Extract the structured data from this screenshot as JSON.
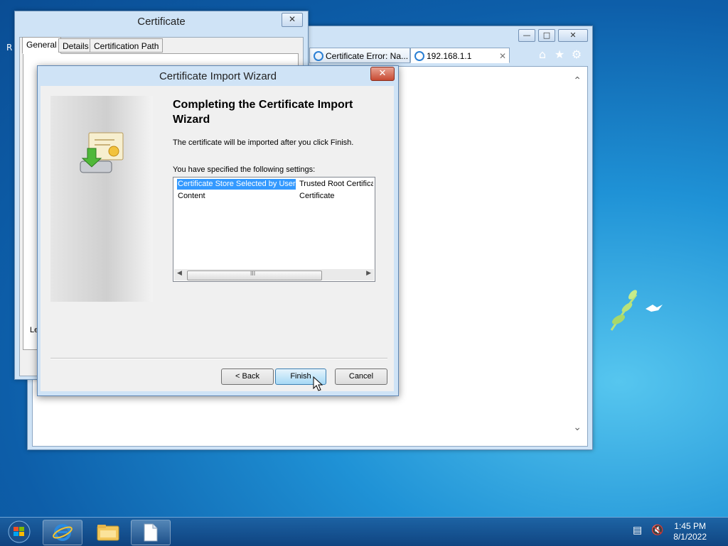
{
  "browser": {
    "tabs": [
      {
        "label": "Certificate Error: Na..."
      },
      {
        "label": "192.168.1.1"
      }
    ],
    "desktop_cut_text": "R"
  },
  "cert_window": {
    "title": "Certificate",
    "tabs": [
      "General",
      "Details",
      "Certification Path"
    ],
    "partial_text": "Le"
  },
  "wizard": {
    "title": "Certificate Import Wizard",
    "heading": "Completing the Certificate Import Wizard",
    "description": "The certificate will be imported after you click Finish.",
    "settings_label": "You have specified the following settings:",
    "settings": [
      {
        "key": "Certificate Store Selected by User",
        "value": "Trusted Root Certifica"
      },
      {
        "key": "Content",
        "value": "Certificate"
      }
    ],
    "scroll_grip": "III",
    "buttons": {
      "back": "< Back",
      "finish": "Finish",
      "cancel": "Cancel"
    }
  },
  "taskbar": {
    "time": "1:45 PM",
    "date": "8/1/2022"
  },
  "colors": {
    "selection": "#3399ff",
    "window_frame": "#cfe3f6",
    "desktop": "#1f92d6"
  },
  "icons": [
    "start-orb-icon",
    "ie-icon",
    "file-explorer-icon",
    "document-icon",
    "network-icon",
    "volume-muted-icon",
    "home-icon",
    "favorites-star-icon",
    "settings-gear-icon",
    "certificate-icon"
  ]
}
